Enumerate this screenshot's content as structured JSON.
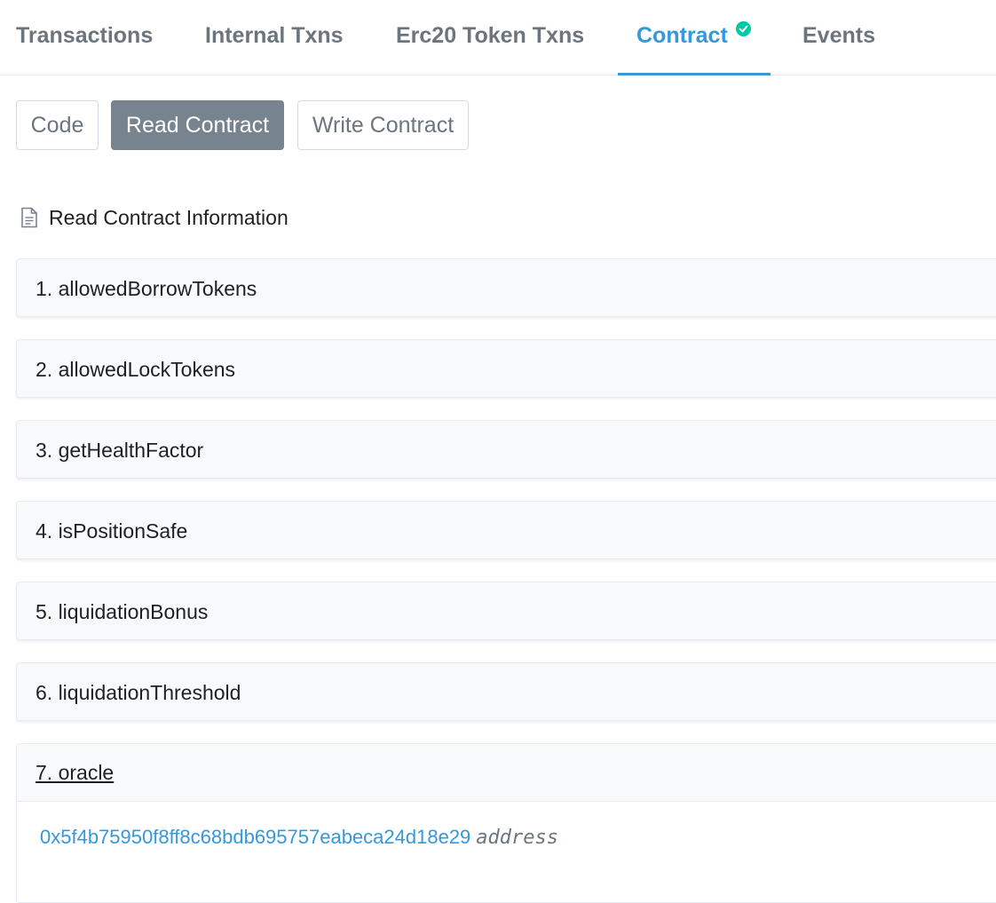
{
  "tabs": [
    {
      "label": "Transactions",
      "active": false
    },
    {
      "label": "Internal Txns",
      "active": false
    },
    {
      "label": "Erc20 Token Txns",
      "active": false
    },
    {
      "label": "Contract",
      "active": true
    },
    {
      "label": "Events",
      "active": false
    }
  ],
  "contract_buttons": [
    {
      "label": "Code",
      "active": false
    },
    {
      "label": "Read Contract",
      "active": true
    },
    {
      "label": "Write Contract",
      "active": false
    }
  ],
  "section_title": "Read Contract Information",
  "functions": [
    {
      "label": "1. allowedBorrowTokens"
    },
    {
      "label": "2. allowedLockTokens"
    },
    {
      "label": "3. getHealthFactor"
    },
    {
      "label": "4. isPositionSafe"
    },
    {
      "label": "5. liquidationBonus"
    },
    {
      "label": "6. liquidationThreshold"
    },
    {
      "label": "7. oracle",
      "expanded": true,
      "result": {
        "value": "0x5f4b75950f8ff8c68bdb695757eabeca24d18e29",
        "type": "address"
      }
    }
  ],
  "colors": {
    "accent": "#3498db",
    "verified": "#00c9a7",
    "active_button": "#77838f"
  }
}
